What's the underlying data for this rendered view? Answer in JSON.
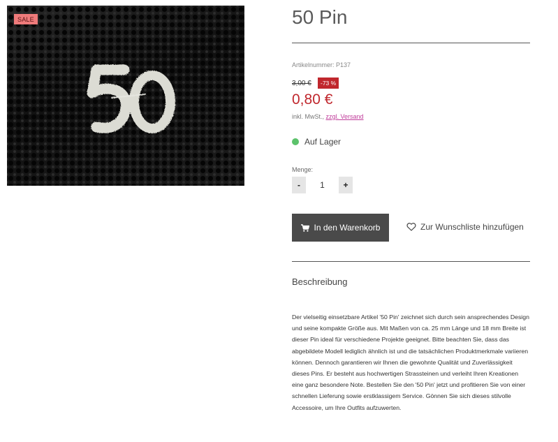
{
  "product": {
    "badge": "SALE",
    "image_alt_icon": "pin-50-image",
    "title": "50 Pin",
    "sku": "Artikelnummer: P137",
    "old_price": "3,00 €",
    "discount": "-73 %",
    "price": "0,80 €",
    "tax_prefix": "inkl. MwSt., ",
    "shipping_link": "zzgl. Versand",
    "stock": "Auf Lager",
    "quantity_label": "Menge:",
    "quantity": "1",
    "minus": "-",
    "plus": "+",
    "cart_button": "In den Warenkorb",
    "wishlist": "Zur Wunschliste hinzufügen",
    "description_heading": "Beschreibung",
    "description": "Der vielseitig einsetzbare Artikel '50 Pin' zeichnet sich durch sein ansprechendes Design und seine kompakte Größe aus. Mit Maßen von ca. 25 mm Länge und 18 mm Breite ist dieser Pin ideal für verschiedene Projekte geeignet. Bitte beachten Sie, dass das abgebildete Modell lediglich ähnlich ist und die tatsächlichen Produktmerkmale variieren können. Dennoch garantieren wir Ihnen die gewohnte Qualität und Zuverlässigkeit dieses Pins. Er besteht aus hochwertigen Strassteinen und verleiht Ihren Kreationen eine ganz besondere Note. Bestellen Sie den '50 Pin' jetzt und profitieren Sie von einer schnellen Lieferung sowie erstklassigem Service. Gönnen Sie sich dieses stilvolle Accessoire, um Ihre Outfits aufzuwerten."
  },
  "colors": {
    "sale_badge": "#ef7b7b",
    "price": "#c0272d",
    "stock_dot": "#5cc26b",
    "cart_button": "#4a4a4a",
    "link": "#c03b9a"
  }
}
